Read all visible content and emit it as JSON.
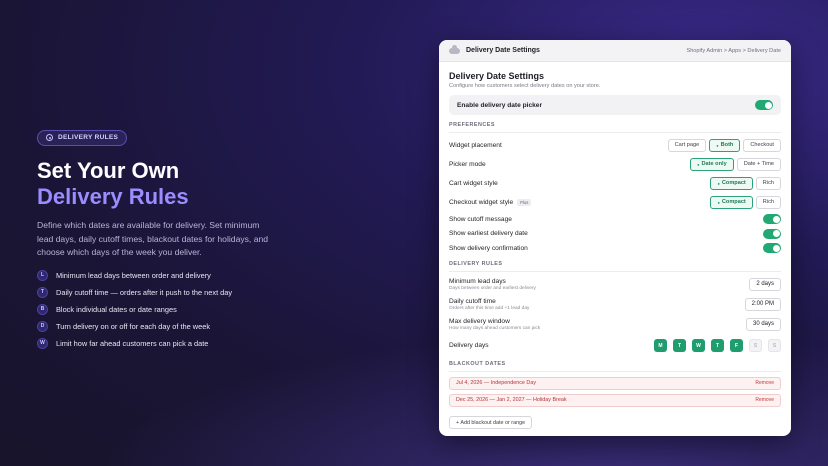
{
  "hero": {
    "pill_icon": "gear-icon",
    "pill_label": "DELIVERY RULES",
    "title_line1": "Set Your Own",
    "title_line2": "Delivery Rules",
    "description": "Define which dates are available for delivery. Set minimum lead days, daily cutoff times, blackout dates for holidays, and choose which days of the week you deliver.",
    "features": [
      {
        "badge": "L",
        "text": "Minimum lead days between order and delivery"
      },
      {
        "badge": "T",
        "text": "Daily cutoff time — orders after it push to the next day"
      },
      {
        "badge": "B",
        "text": "Block individual dates or date ranges"
      },
      {
        "badge": "D",
        "text": "Turn delivery on or off for each day of the week"
      },
      {
        "badge": "W",
        "text": "Limit how far ahead customers can pick a date"
      }
    ]
  },
  "window": {
    "title": "Delivery Date Settings",
    "breadcrumb": "Shopify Admin > Apps > Delivery Date",
    "page_title": "Delivery Date Settings",
    "page_subtitle": "Configure how customers select delivery dates on your store.",
    "enable_label": "Enable delivery date picker",
    "enable_on": true
  },
  "preferences": {
    "heading": "PREFERENCES",
    "widget_placement": {
      "label": "Widget placement",
      "options": [
        "Cart page",
        "Both",
        "Checkout"
      ],
      "selected": "Both"
    },
    "picker_mode": {
      "label": "Picker mode",
      "options": [
        "Date only",
        "Date + Time"
      ],
      "selected": "Date only"
    },
    "cart_style": {
      "label": "Cart widget style",
      "options": [
        "Compact",
        "Rich"
      ],
      "selected": "Compact"
    },
    "checkout_style": {
      "label": "Checkout widget style",
      "tag": "Plus",
      "options": [
        "Compact",
        "Rich"
      ],
      "selected": "Compact"
    },
    "toggles": [
      {
        "label": "Show cutoff message",
        "on": true
      },
      {
        "label": "Show earliest delivery date",
        "on": true
      },
      {
        "label": "Show delivery confirmation",
        "on": true
      }
    ]
  },
  "rules": {
    "heading": "DELIVERY RULES",
    "lead": {
      "label": "Minimum lead days",
      "sub": "Days between order and earliest delivery",
      "value": "2 days"
    },
    "cutoff": {
      "label": "Daily cutoff time",
      "sub": "Orders after this time add +1 lead day",
      "value": "2:00 PM"
    },
    "window": {
      "label": "Max delivery window",
      "sub": "How many days ahead customers can pick",
      "value": "30 days"
    },
    "days_label": "Delivery days",
    "days": [
      {
        "letter": "M",
        "on": true
      },
      {
        "letter": "T",
        "on": true
      },
      {
        "letter": "W",
        "on": true
      },
      {
        "letter": "T",
        "on": true
      },
      {
        "letter": "F",
        "on": true
      },
      {
        "letter": "S",
        "on": false
      },
      {
        "letter": "S",
        "on": false
      }
    ]
  },
  "blackout": {
    "heading": "BLACKOUT DATES",
    "items": [
      {
        "text": "Jul 4, 2026 — Independence Day",
        "remove": "Remove"
      },
      {
        "text": "Dec 25, 2026 — Jan 2, 2027 — Holiday Break",
        "remove": "Remove"
      }
    ],
    "add_label": "+ Add blackout date or range"
  },
  "colors": {
    "accent": "#21a873",
    "brand_purple": "#9b8cff",
    "danger": "#b23636"
  }
}
